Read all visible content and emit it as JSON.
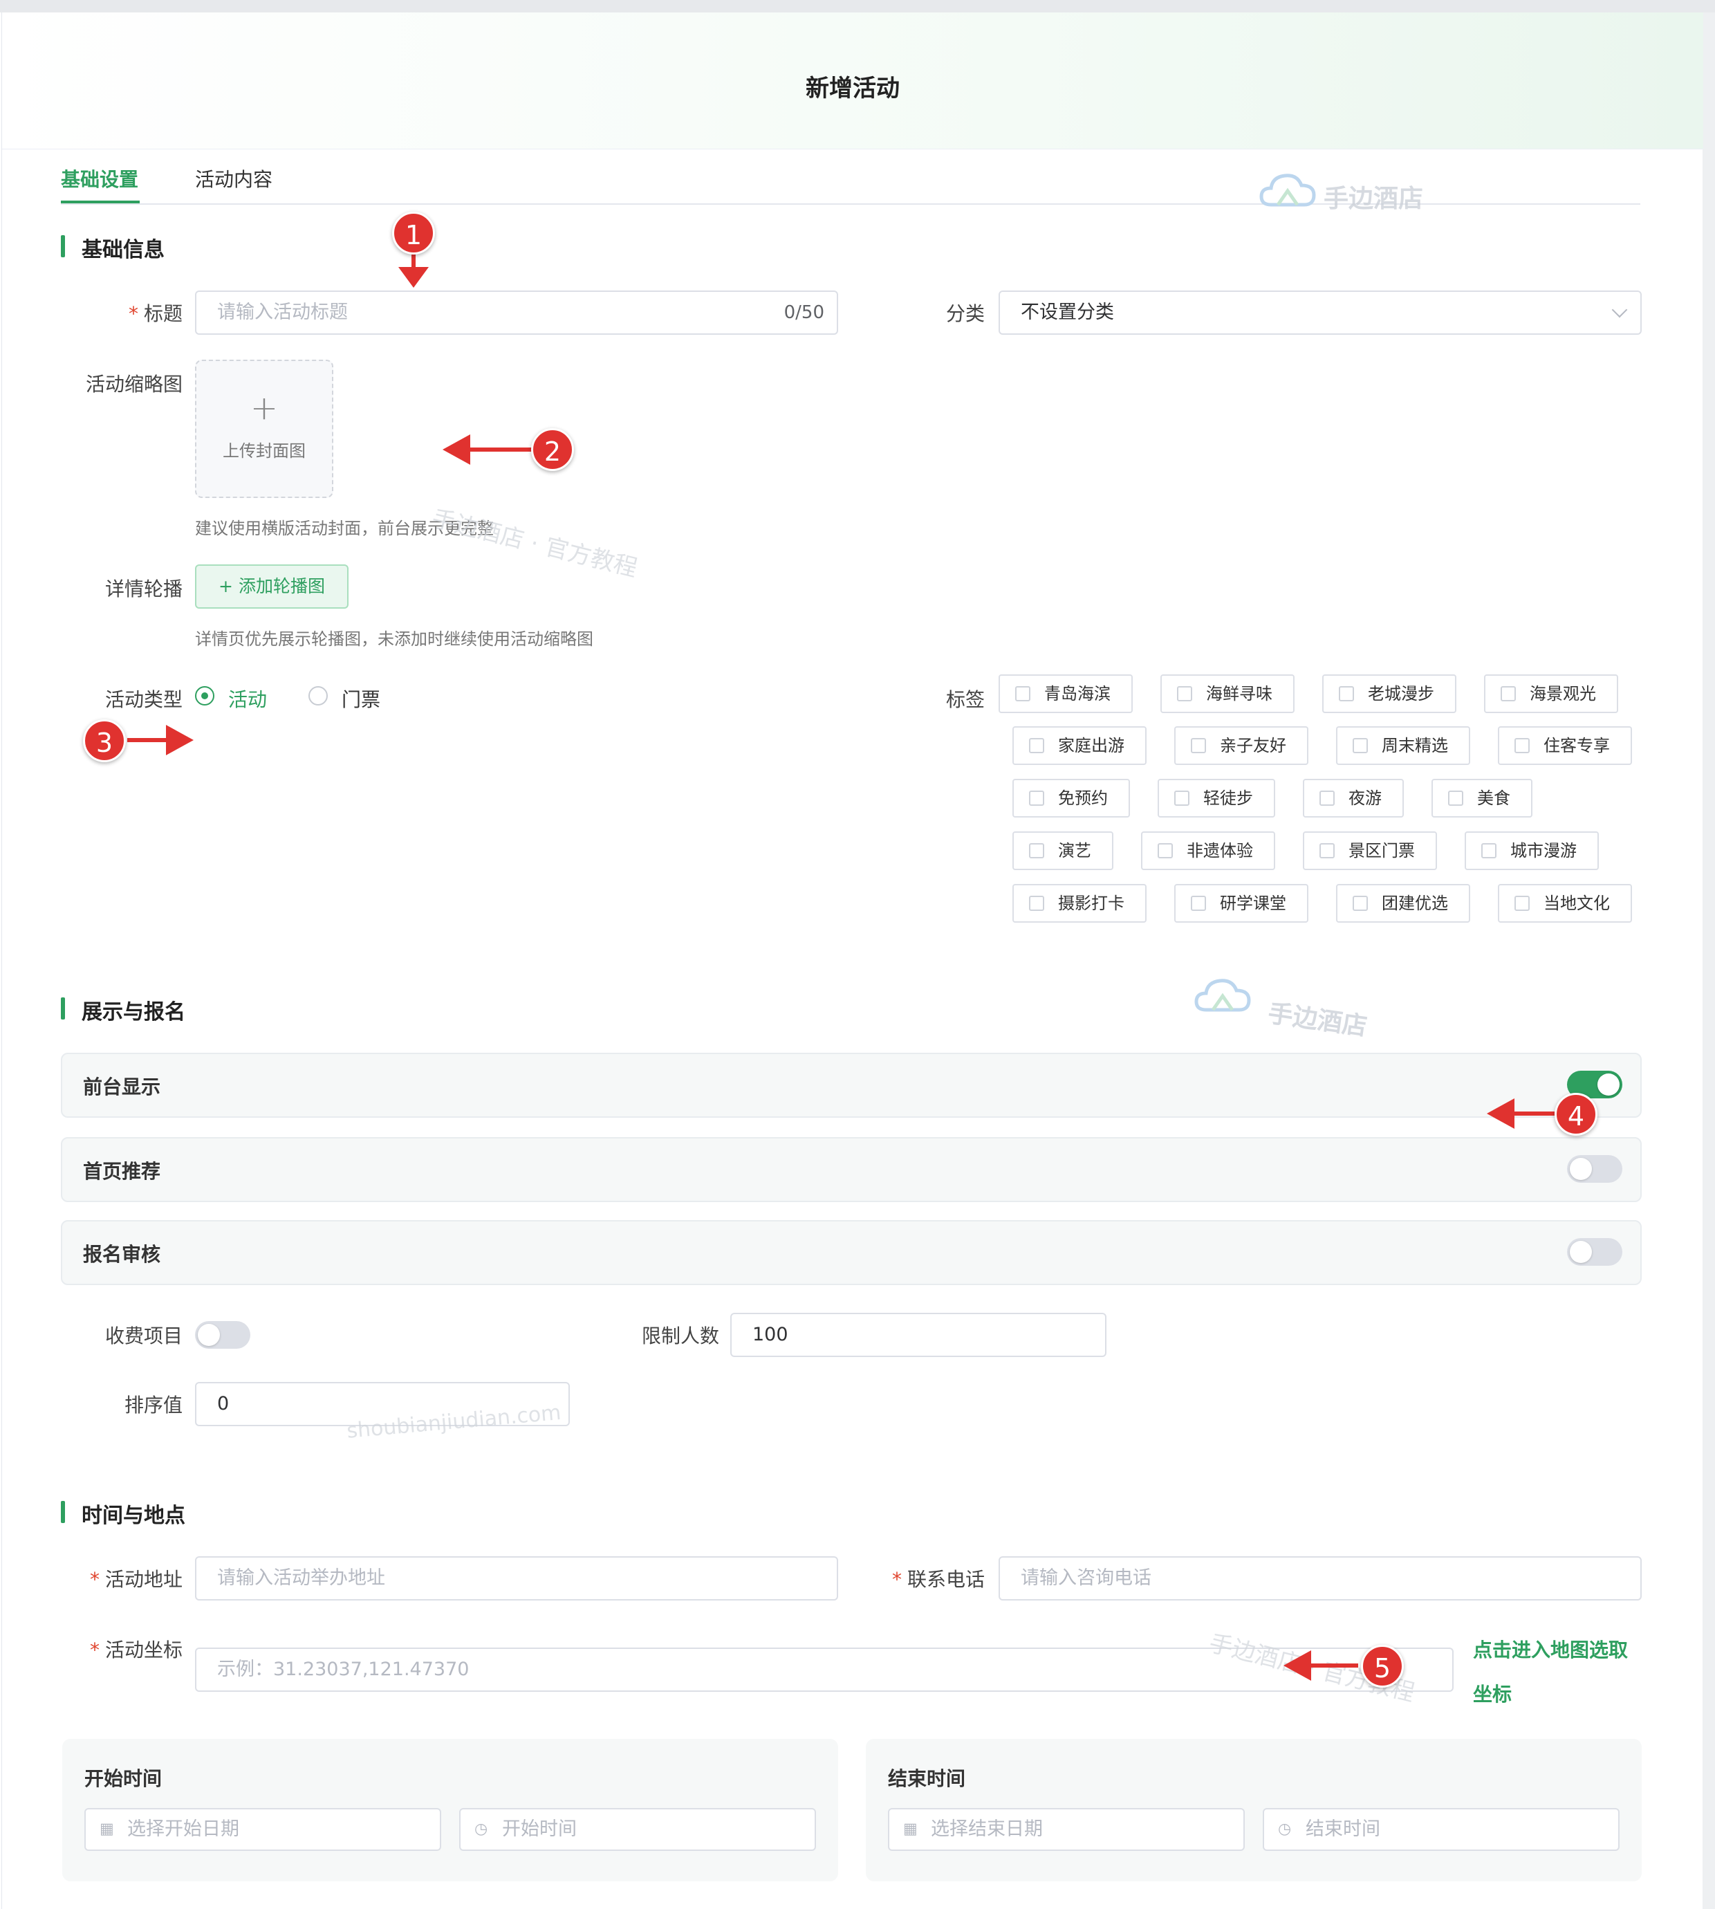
{
  "dialog": {
    "title": "新增活动"
  },
  "tabs": [
    {
      "label": "基础设置",
      "active": true
    },
    {
      "label": "活动内容",
      "active": false
    }
  ],
  "sections": {
    "basic": "基础信息",
    "display": "展示与报名",
    "time_location": "时间与地点"
  },
  "basic": {
    "title_label": "标题",
    "title_placeholder": "请输入活动标题",
    "title_counter": "0/50",
    "category_label": "分类",
    "category_value": "不设置分类",
    "thumbnail_label": "活动缩略图",
    "upload_plus": "+",
    "upload_text": "上传封面图",
    "thumbnail_hint": "建议使用横版活动封面，前台展示更完整",
    "carousel_label": "详情轮播",
    "carousel_button": "+ 添加轮播图",
    "carousel_hint": "详情页优先展示轮播图，未添加时继续使用活动缩略图",
    "type_label": "活动类型",
    "type_options": [
      {
        "label": "活动",
        "selected": true
      },
      {
        "label": "门票",
        "selected": false
      }
    ],
    "tags_label": "标签",
    "tags": [
      "青岛海滨",
      "海鲜寻味",
      "老城漫步",
      "海景观光",
      "家庭出游",
      "亲子友好",
      "周末精选",
      "住客专享",
      "免预约",
      "轻徒步",
      "夜游",
      "美食",
      "演艺",
      "非遗体验",
      "景区门票",
      "城市漫游",
      "摄影打卡",
      "研学课堂",
      "团建优选",
      "当地文化"
    ]
  },
  "display": {
    "panels": [
      {
        "label": "前台显示",
        "on": true
      },
      {
        "label": "首页推荐",
        "on": false
      },
      {
        "label": "报名审核",
        "on": false
      }
    ],
    "fee_label": "收费项目",
    "fee_on": false,
    "limit_label": "限制人数",
    "limit_value": "100",
    "sort_label": "排序值",
    "sort_value": "0"
  },
  "time_location": {
    "address_label": "活动地址",
    "address_placeholder": "请输入活动举办地址",
    "phone_label": "联系电话",
    "phone_placeholder": "请输入咨询电话",
    "coord_label": "活动坐标",
    "coord_placeholder": "示例：31.23037,121.47370",
    "map_link": "点击进入地图选取坐标",
    "start_title": "开始时间",
    "start_date_placeholder": "选择开始日期",
    "start_time_placeholder": "开始时间",
    "end_title": "结束时间",
    "end_date_placeholder": "选择结束日期",
    "end_time_placeholder": "结束时间"
  },
  "annotations": [
    "1",
    "2",
    "3",
    "4",
    "5"
  ],
  "watermarks": {
    "brand": "手边酒店",
    "tutorial": "手边酒店 · 官方教程",
    "domain": "shoubianjiudian.com"
  },
  "colors": {
    "accent": "#2e9f5f",
    "annotation": "#e0322f",
    "required": "#e0452f"
  }
}
